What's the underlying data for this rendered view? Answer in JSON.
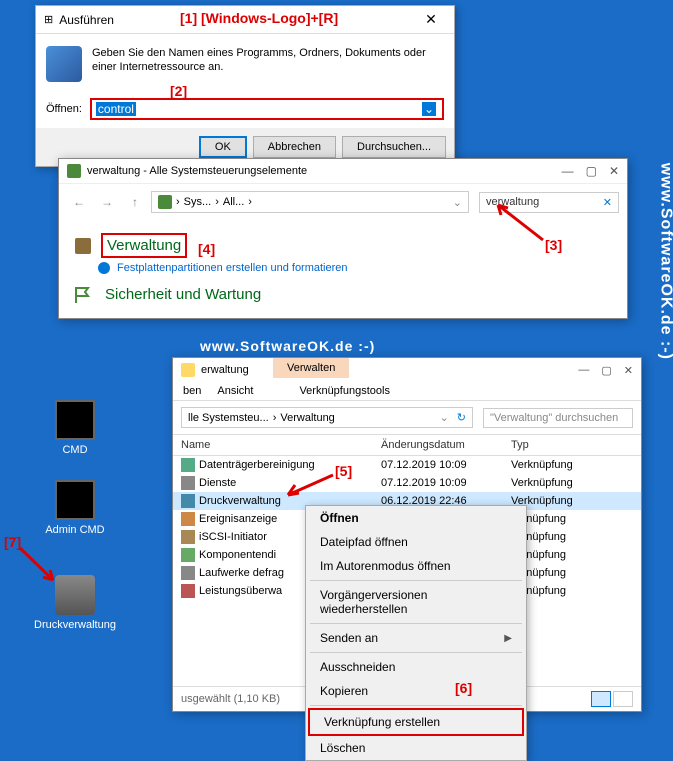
{
  "watermark": "www.SoftwareOK.de :-)",
  "annotations": {
    "a1": "[1] [Windows-Logo]+[R]",
    "a2": "[2]",
    "a3": "[3]",
    "a4": "[4]",
    "a5": "[5]",
    "a6": "[6]",
    "a7": "[7]"
  },
  "run": {
    "title": "Ausführen",
    "description": "Geben Sie den Namen eines Programms, Ordners, Dokuments oder einer Internetressource an.",
    "open_label": "Öffnen:",
    "input_value": "control",
    "ok": "OK",
    "cancel": "Abbrechen",
    "browse": "Durchsuchen..."
  },
  "cp": {
    "title": "verwaltung - Alle Systemsteuerungselemente",
    "bc1": "Sys...",
    "bc2": "All...",
    "search": "verwaltung",
    "item1": "Verwaltung",
    "sub1": "Festplattenpartitionen erstellen und formatieren",
    "item2": "Sicherheit und Wartung"
  },
  "ex": {
    "title": "erwaltung",
    "ribbon": "Verwalten",
    "ribbon_sub": "Verknüpfungstools",
    "menu_view": "Ansicht",
    "menu_tools": "ben",
    "bc1": "lle Systemsteu...",
    "bc2": "Verwaltung",
    "search_placeholder": "\"Verwaltung\" durchsuchen",
    "col_name": "Name",
    "col_date": "Änderungsdatum",
    "col_type": "Typ",
    "rows": [
      {
        "name": "Datenträgerbereinigung",
        "date": "07.12.2019 10:09",
        "type": "Verknüpfung"
      },
      {
        "name": "Dienste",
        "date": "07.12.2019 10:09",
        "type": "Verknüpfung"
      },
      {
        "name": "Druckverwaltung",
        "date": "06.12.2019 22:46",
        "type": "Verknüpfung"
      },
      {
        "name": "Ereignisanzeige",
        "date": "",
        "type": "erknüpfung"
      },
      {
        "name": "iSCSI-Initiator",
        "date": "",
        "type": "erknüpfung"
      },
      {
        "name": "Komponentendi",
        "date": "",
        "type": "erknüpfung"
      },
      {
        "name": "Laufwerke defrag",
        "date": "",
        "type": "erknüpfung"
      },
      {
        "name": "Leistungsüberwa",
        "date": "",
        "type": "erknüpfung"
      }
    ],
    "status": "usgewählt (1,10 KB)"
  },
  "ctx": {
    "open": "Öffnen",
    "open_path": "Dateipfad öffnen",
    "author": "Im Autorenmodus öffnen",
    "prev": "Vorgängerversionen wiederherstellen",
    "send": "Senden an",
    "cut": "Ausschneiden",
    "copy": "Kopieren",
    "link": "Verknüpfung erstellen",
    "delete": "Löschen"
  },
  "desktop": {
    "cmd": "CMD",
    "admin_cmd": "Admin CMD",
    "printer": "Druckverwaltung"
  }
}
